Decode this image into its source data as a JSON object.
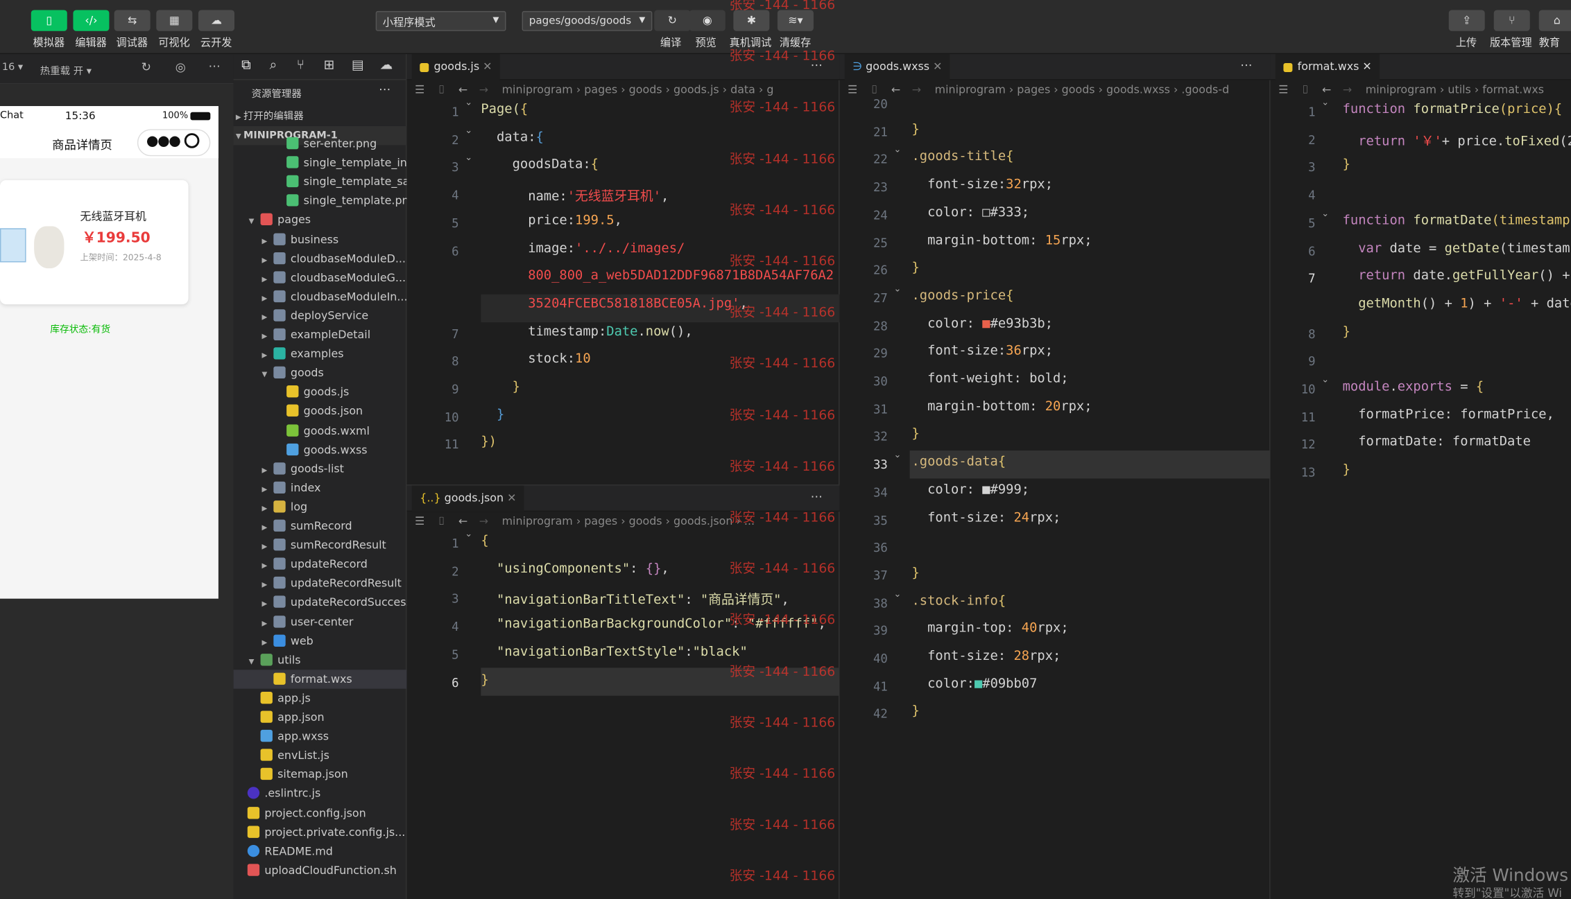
{
  "toolbar": {
    "buttons": [
      {
        "label": "模拟器"
      },
      {
        "label": "编辑器"
      },
      {
        "label": "调试器"
      },
      {
        "label": "可视化"
      },
      {
        "label": "云开发"
      }
    ],
    "mode": "小程序模式",
    "page_path": "pages/goods/goods",
    "mid": [
      {
        "label": "编译"
      },
      {
        "label": "预览"
      },
      {
        "label": "真机调试"
      },
      {
        "label": "清缓存"
      }
    ],
    "right": [
      {
        "label": "上传"
      },
      {
        "label": "版本管理"
      },
      {
        "label": "教育"
      }
    ]
  },
  "sim": {
    "scale": "16 ▾",
    "hot": "热重载 开 ▾",
    "status_left": "Chat",
    "time": "15:36",
    "battery": "100%",
    "nav_title": "商品详情页",
    "product_name": "无线蓝牙耳机",
    "price": "￥199.50",
    "listed": "上架时间：2025-4-8",
    "stock": "库存状态:有货"
  },
  "explorer": {
    "title": "资源管理器",
    "open_editors": "打开的编辑器",
    "project": "MINIPROGRAM-1",
    "rows": [
      {
        "label": "ser-enter.png",
        "kind": "img",
        "indent": 3
      },
      {
        "label": "single_template_inf...",
        "kind": "img",
        "indent": 3
      },
      {
        "label": "single_template_sa...",
        "kind": "img",
        "indent": 3
      },
      {
        "label": "single_template.png",
        "kind": "img",
        "indent": 3
      },
      {
        "label": "pages",
        "kind": "folder-red",
        "indent": 1,
        "open": true
      },
      {
        "label": "business",
        "kind": "folder",
        "indent": 2
      },
      {
        "label": "cloudbaseModuleD...",
        "kind": "folder",
        "indent": 2
      },
      {
        "label": "cloudbaseModuleG...",
        "kind": "folder",
        "indent": 2
      },
      {
        "label": "cloudbaseModuleIn...",
        "kind": "folder",
        "indent": 2
      },
      {
        "label": "deployService",
        "kind": "folder",
        "indent": 2
      },
      {
        "label": "exampleDetail",
        "kind": "folder",
        "indent": 2
      },
      {
        "label": "examples",
        "kind": "folder-teal",
        "indent": 2
      },
      {
        "label": "goods",
        "kind": "folder",
        "indent": 2,
        "open": true
      },
      {
        "label": "goods.js",
        "kind": "js",
        "indent": 3
      },
      {
        "label": "goods.json",
        "kind": "json",
        "indent": 3
      },
      {
        "label": "goods.wxml",
        "kind": "wxml",
        "indent": 3
      },
      {
        "label": "goods.wxss",
        "kind": "wxss",
        "indent": 3
      },
      {
        "label": "goods-list",
        "kind": "folder",
        "indent": 2
      },
      {
        "label": "index",
        "kind": "folder",
        "indent": 2
      },
      {
        "label": "log",
        "kind": "folder-yellow",
        "indent": 2
      },
      {
        "label": "sumRecord",
        "kind": "folder",
        "indent": 2
      },
      {
        "label": "sumRecordResult",
        "kind": "folder",
        "indent": 2
      },
      {
        "label": "updateRecord",
        "kind": "folder",
        "indent": 2
      },
      {
        "label": "updateRecordResult",
        "kind": "folder",
        "indent": 2
      },
      {
        "label": "updateRecordSuccess",
        "kind": "folder",
        "indent": 2
      },
      {
        "label": "user-center",
        "kind": "folder",
        "indent": 2
      },
      {
        "label": "web",
        "kind": "folder-blue",
        "indent": 2
      },
      {
        "label": "utils",
        "kind": "folder-green",
        "indent": 1,
        "open": true
      },
      {
        "label": "format.wxs",
        "kind": "js",
        "indent": 2,
        "selected": true
      },
      {
        "label": "app.js",
        "kind": "js",
        "indent": 1
      },
      {
        "label": "app.json",
        "kind": "json",
        "indent": 1
      },
      {
        "label": "app.wxss",
        "kind": "wxss",
        "indent": 1
      },
      {
        "label": "envList.js",
        "kind": "js",
        "indent": 1
      },
      {
        "label": "sitemap.json",
        "kind": "json",
        "indent": 1
      },
      {
        "label": ".eslintrc.js",
        "kind": "eslint",
        "indent": 0
      },
      {
        "label": "project.config.json",
        "kind": "json",
        "indent": 0
      },
      {
        "label": "project.private.config.js...",
        "kind": "json",
        "indent": 0
      },
      {
        "label": "README.md",
        "kind": "info",
        "indent": 0
      },
      {
        "label": "uploadCloudFunction.sh",
        "kind": "sh",
        "indent": 0
      }
    ]
  },
  "editor_js": {
    "tab": "goods.js",
    "crumb": "miniprogram › pages › goods › goods.js › data › g"
  },
  "editor_json": {
    "tab": "goods.json",
    "crumb": "miniprogram › pages › goods › goods.json › ..."
  },
  "editor_wxss": {
    "tab": "goods.wxss",
    "crumb": "miniprogram › pages › goods › goods.wxss › .goods-d"
  },
  "editor_wxs": {
    "tab": "format.wxs",
    "crumb": "miniprogram › utils › format.wxs"
  },
  "watermark": "张安 -144 - 1166",
  "activation": {
    "line1": "激活 Windows",
    "line2": "转到\"设置\"以激活 Wi"
  },
  "colors": {
    "accent": "#07c160",
    "price": "#e93b3b",
    "stock": "#09bb07"
  }
}
